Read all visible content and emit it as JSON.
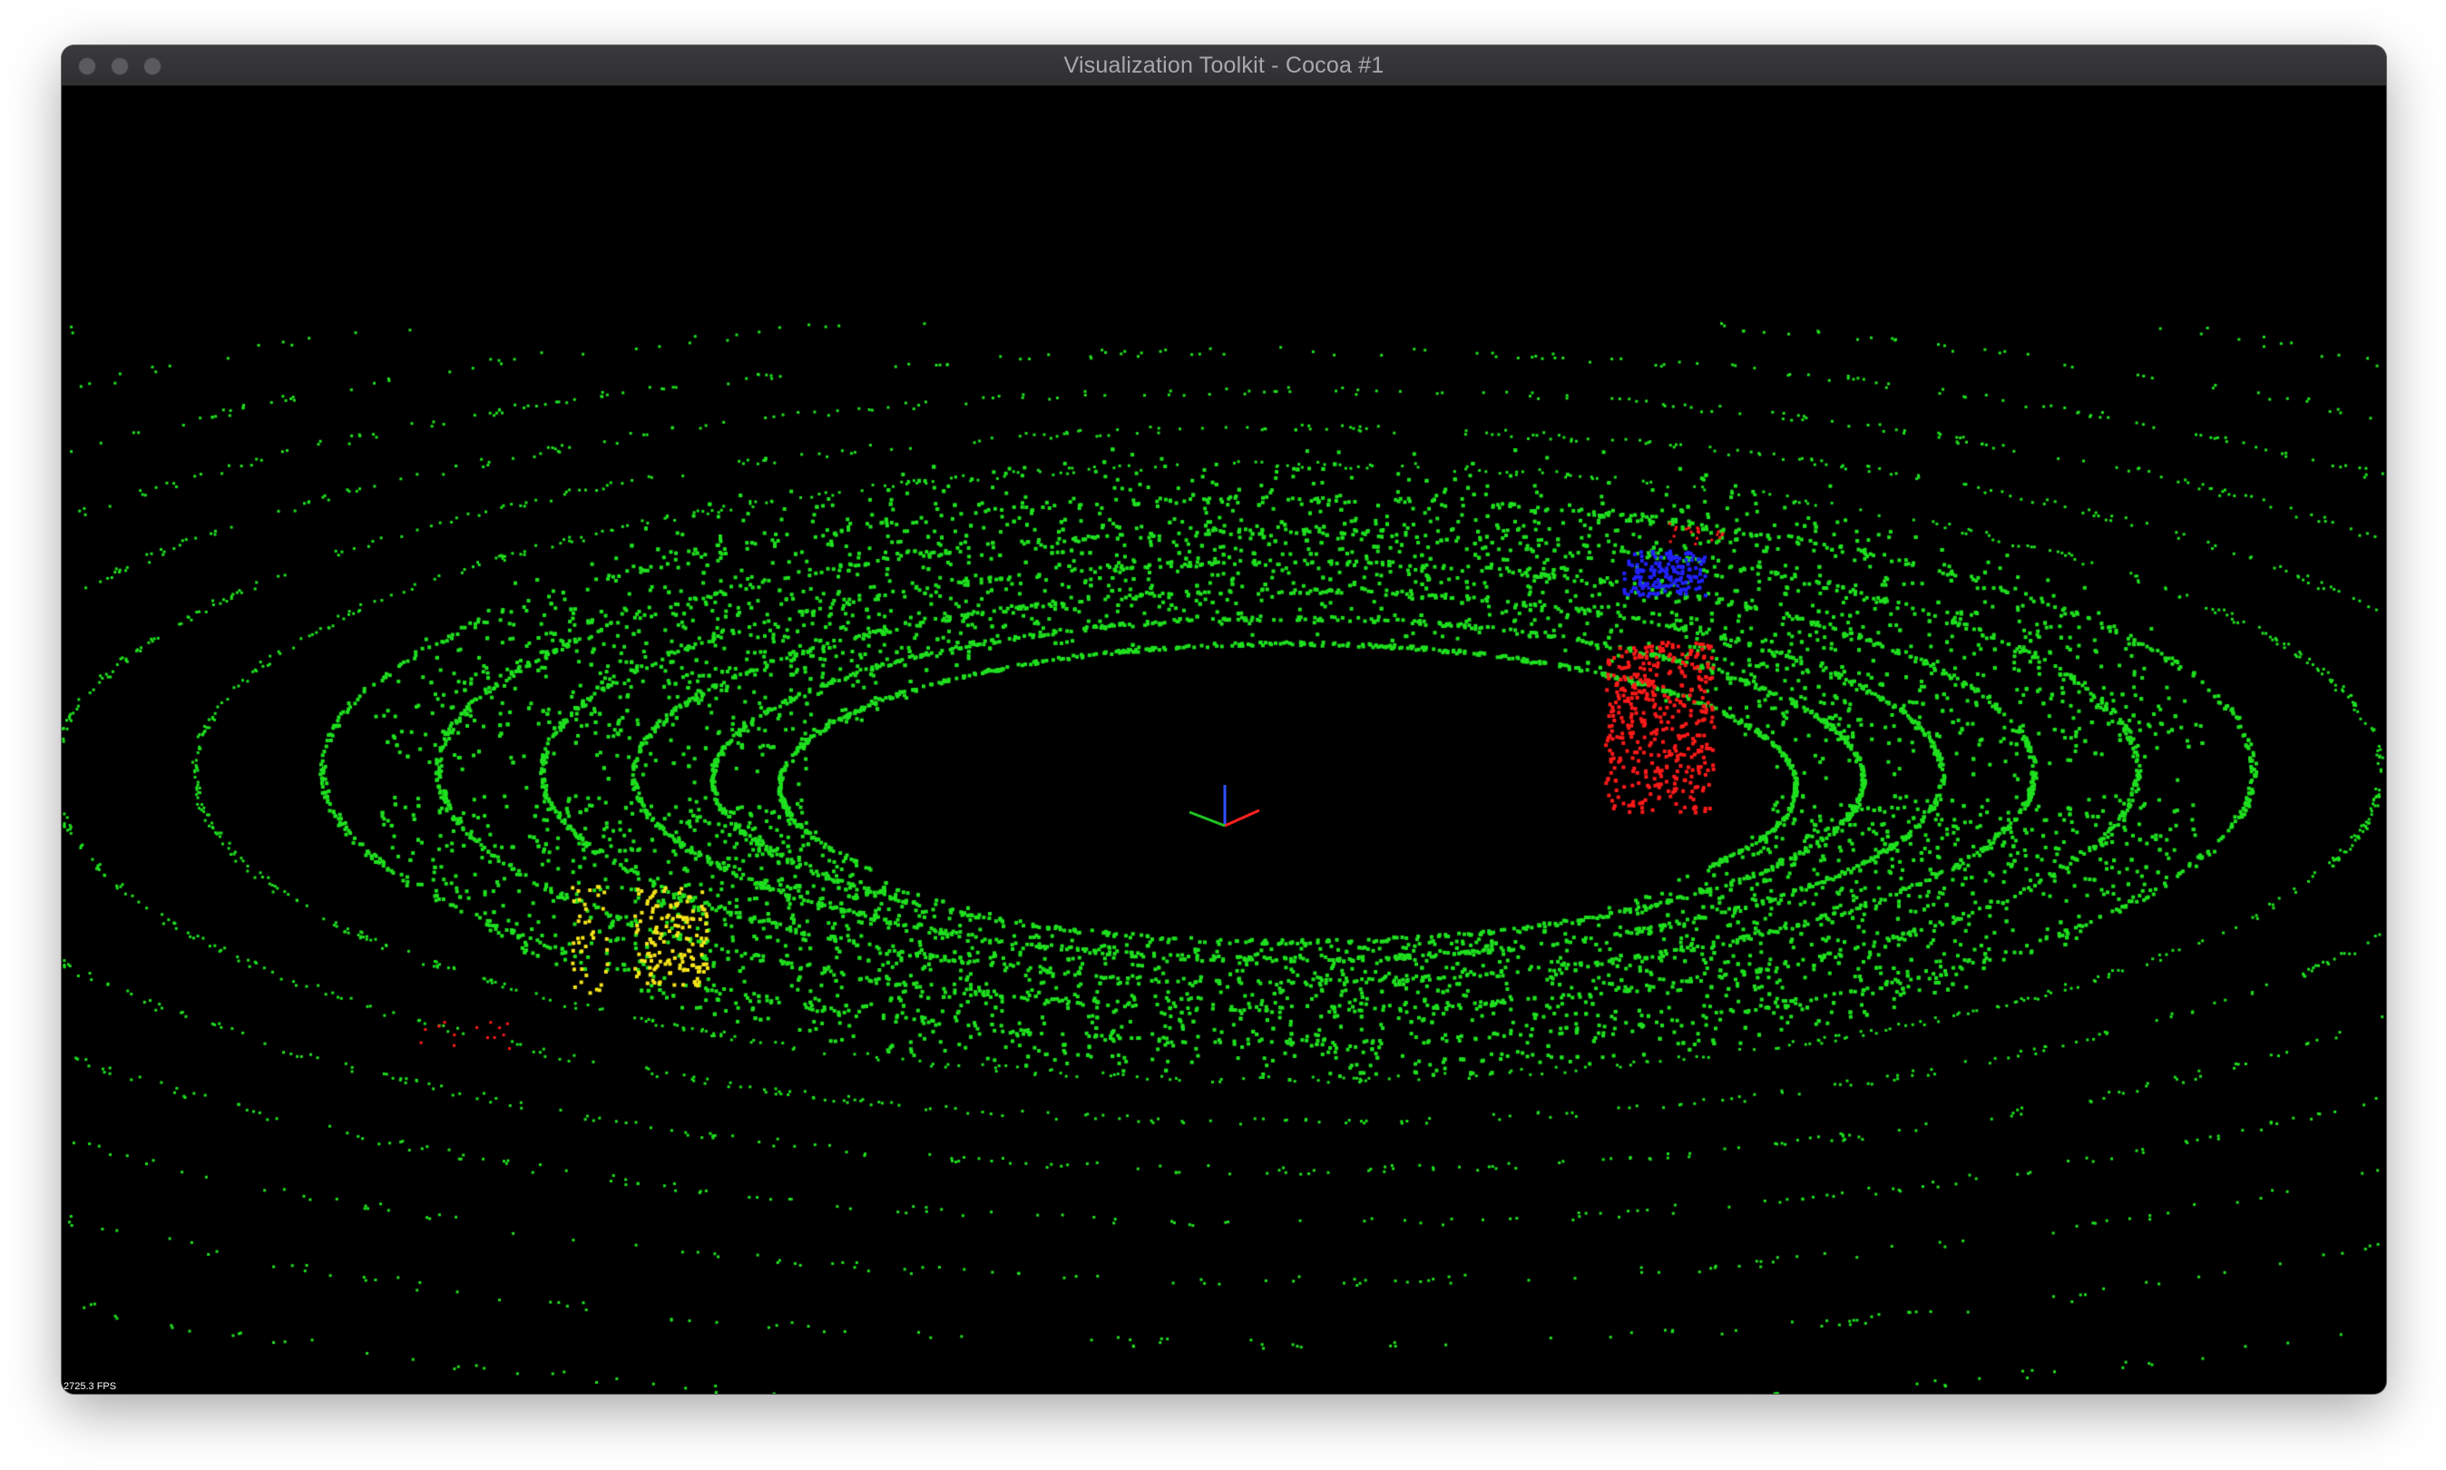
{
  "window": {
    "title": "Visualization Toolkit - Cocoa #1",
    "buttons": [
      {
        "name": "close-button",
        "color": "#5b5b5e"
      },
      {
        "name": "minimize-button",
        "color": "#5b5b5e"
      },
      {
        "name": "maximize-button",
        "color": "#5b5b5e"
      }
    ]
  },
  "viewport": {
    "background": "#000000",
    "fps_text": "2725.3 FPS"
  },
  "point_cloud": {
    "ground_color": "#1fe01f",
    "clusters": [
      {
        "label": "",
        "color": "#ff1a1a"
      },
      {
        "label": "",
        "color": "#2222ff"
      },
      {
        "label": "",
        "color": "#f5e51a"
      }
    ]
  },
  "axes": {
    "x_color": "#ff2020",
    "y_color": "#20c020",
    "z_color": "#3050ff"
  }
}
